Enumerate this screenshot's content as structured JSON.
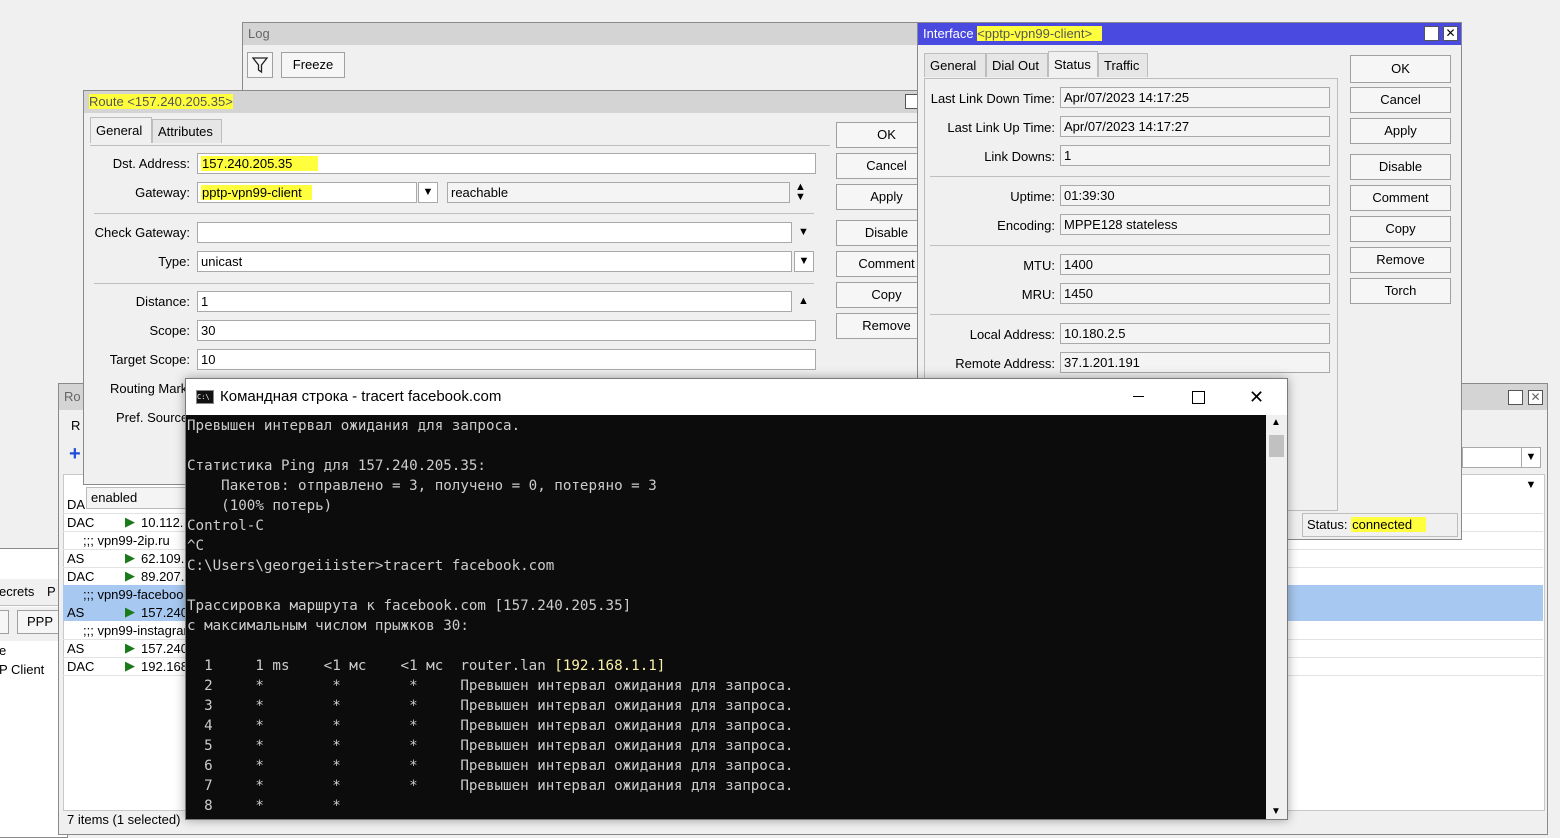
{
  "log_window": {
    "title": "Log",
    "freeze_label": "Freeze",
    "filter_icon": "filter-icon"
  },
  "routes_window": {
    "title_fragment": "Ro",
    "tab_fragment": "R",
    "status_text": "enabled",
    "items_count": "7 items (1 selected)",
    "rows": [
      {
        "type": "DA",
        "dst": ""
      },
      {
        "type": "DAC",
        "dst": "10.112."
      },
      {
        "type": "",
        "dst": ";;; vpn99-2ip.ru"
      },
      {
        "type": "AS",
        "dst": "62.109."
      },
      {
        "type": "DAC",
        "dst": "89.207.2"
      },
      {
        "type": "",
        "dst": ";;; vpn99-faceboo"
      },
      {
        "type": "AS",
        "dst": "157.240"
      },
      {
        "type": "",
        "dst": ";;; vpn99-instagran"
      },
      {
        "type": "AS",
        "dst": "157.240"
      },
      {
        "type": "DAC",
        "dst": "192.168"
      }
    ]
  },
  "ppp_window": {
    "tab_secrets": "ecrets",
    "tab_p": "P",
    "ppp_button": "PPP",
    "row_e": "e",
    "row_client": "P Client"
  },
  "route_window": {
    "title": "Route <157.240.205.35>",
    "tabs": [
      "General",
      "Attributes"
    ],
    "dst_label": "Dst. Address:",
    "dst_value": "157.240.205.35",
    "gateway_label": "Gateway:",
    "gateway_value": "pptp-vpn99-client",
    "gateway_state": "reachable",
    "check_gateway_label": "Check Gateway:",
    "check_gateway_value": "",
    "type_label": "Type:",
    "type_value": "unicast",
    "distance_label": "Distance:",
    "distance_value": "1",
    "scope_label": "Scope:",
    "scope_value": "30",
    "target_scope_label": "Target Scope:",
    "target_scope_value": "10",
    "routing_mark_label": "Routing Mark",
    "pref_source_label": "Pref. Source",
    "buttons": [
      "OK",
      "Cancel",
      "Apply",
      "Disable",
      "Comment",
      "Copy",
      "Remove"
    ]
  },
  "interface_window": {
    "title_prefix": "Interface ",
    "title_name": "<pptp-vpn99-client>",
    "tabs": [
      "General",
      "Dial Out",
      "Status",
      "Traffic"
    ],
    "fields": [
      {
        "label": "Last Link Down Time:",
        "value": "Apr/07/2023 14:17:25"
      },
      {
        "label": "Last Link Up Time:",
        "value": "Apr/07/2023 14:17:27"
      },
      {
        "label": "Link Downs:",
        "value": "1"
      },
      {
        "label": "Uptime:",
        "value": "01:39:30"
      },
      {
        "label": "Encoding:",
        "value": "MPPE128 stateless"
      },
      {
        "label": "MTU:",
        "value": "1400"
      },
      {
        "label": "MRU:",
        "value": "1450"
      },
      {
        "label": "Local Address:",
        "value": "10.180.2.5"
      },
      {
        "label": "Remote Address:",
        "value": "37.1.201.191"
      }
    ],
    "buttons": [
      "OK",
      "Cancel",
      "Apply",
      "Disable",
      "Comment",
      "Copy",
      "Remove",
      "Torch"
    ],
    "status_label": "Status:",
    "status_value": "connected"
  },
  "cmd_window": {
    "title": "Командная строка - tracert  facebook.com",
    "lines": [
      "Превышен интервал ожидания для запроса.",
      "",
      "Статистика Ping для 157.240.205.35:",
      "    Пакетов: отправлено = 3, получено = 0, потеряно = 3",
      "    (100% потерь)",
      "Control-C",
      "^C",
      "C:\\Users\\georgeiiister>tracert facebook.com",
      "",
      "Трассировка маршрута к facebook.com [157.240.205.35]",
      "с максимальным числом прыжков 30:",
      "",
      "  1     1 ms    <1 мс    <1 мс  router.lan ",
      "  2     *        *        *     Превышен интервал ожидания для запроса.",
      "  3     *        *        *     Превышен интервал ожидания для запроса.",
      "  4     *        *        *     Превышен интервал ожидания для запроса.",
      "  5     *        *        *     Превышен интервал ожидания для запроса.",
      "  6     *        *        *     Превышен интервал ожидания для запроса.",
      "  7     *        *        *     Превышен интервал ожидания для запроса.",
      "  8     *        *"
    ],
    "hop1_ip": "[192.168.1.1]"
  },
  "colors": {
    "highlight": "#ffff3d",
    "interface_title_bg": "#4a4ae0",
    "selected_row": "#a7c8f0",
    "console_bg": "#0c0c0c"
  }
}
